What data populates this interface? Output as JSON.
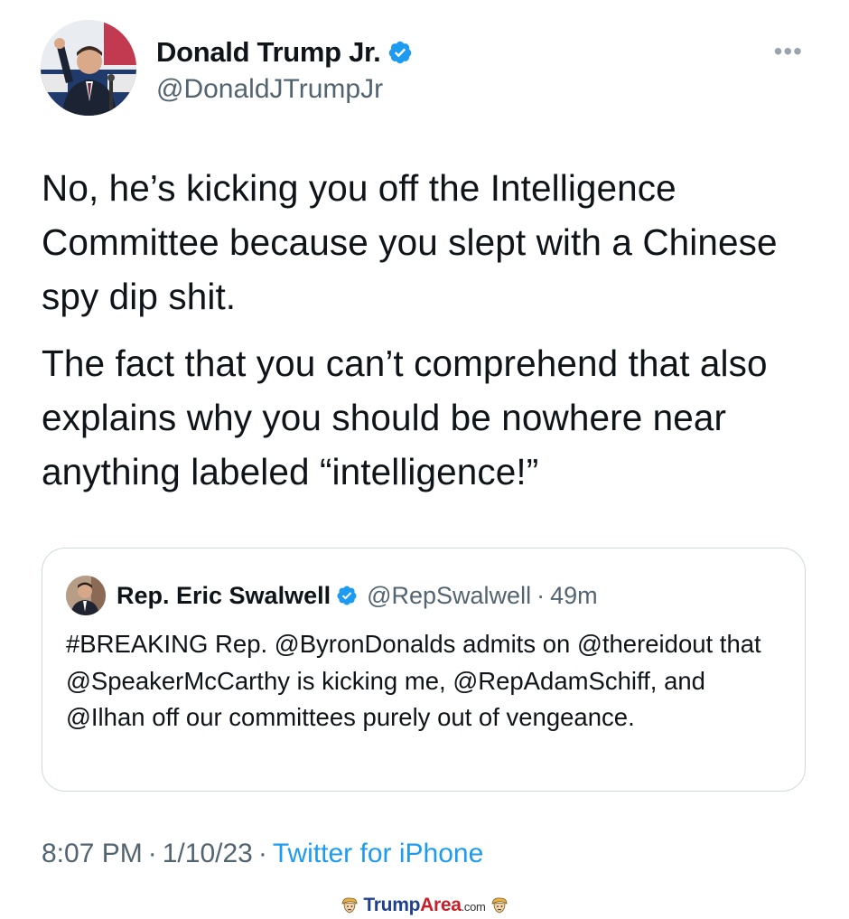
{
  "author": {
    "display_name": "Donald Trump Jr.",
    "handle": "@DonaldJTrumpJr"
  },
  "tweet": {
    "paragraphs": [
      "No, he’s kicking you off the Intelligence Committee because you slept with a Chinese spy dip shit.",
      "The fact that you can’t comprehend that also explains why you should be nowhere near anything labeled “intelligence!”"
    ],
    "time": "8:07 PM",
    "date": "1/10/23",
    "source": "Twitter for iPhone",
    "separator": "·"
  },
  "quote": {
    "display_name": "Rep. Eric Swalwell",
    "handle": "@RepSwalwell",
    "separator": "·",
    "time": "49m",
    "text": "#BREAKING Rep. @ByronDonalds admits on @thereidout that @SpeakerMcCarthy is kicking me, @RepAdamSchiff, and @Ilhan off our committees purely out of vengeance."
  },
  "watermark": {
    "brand_part1": "Trump",
    "brand_part2": "Area",
    "tld": ".com"
  },
  "colors": {
    "verified_blue": "#1d9bf0",
    "link_blue": "#1d9bf0",
    "secondary_text": "#536471"
  },
  "icons": [
    "verified-badge-icon",
    "more-options-icon",
    "trump-face-icon"
  ]
}
